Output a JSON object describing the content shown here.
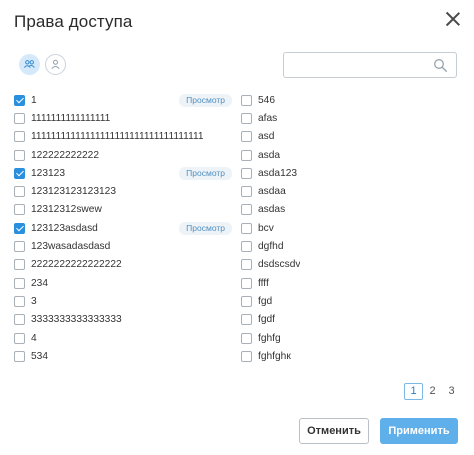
{
  "dialog": {
    "title": "Права доступа"
  },
  "icons": {
    "close": "close-icon",
    "mode_group": "users-group-icon",
    "mode_user": "single-user-icon",
    "search": "search-icon"
  },
  "colors": {
    "accent": "#2a8fdd",
    "apply_button": "#5fb0ea",
    "badge_bg": "#eef3f7",
    "badge_text": "#4f8fc0"
  },
  "search": {
    "placeholder": "",
    "value": ""
  },
  "left_items": [
    {
      "label": "1",
      "checked": true,
      "badge": "Просмотр"
    },
    {
      "label": "1111111111111111",
      "checked": false,
      "badge": ""
    },
    {
      "label": "11111111111111111111111111111111111",
      "checked": false,
      "badge": ""
    },
    {
      "label": "122222222222",
      "checked": false,
      "badge": ""
    },
    {
      "label": "123123",
      "checked": true,
      "badge": "Просмотр"
    },
    {
      "label": "123123123123123",
      "checked": false,
      "badge": ""
    },
    {
      "label": "12312312swew",
      "checked": false,
      "badge": ""
    },
    {
      "label": "123123asdasd",
      "checked": true,
      "badge": "Просмотр"
    },
    {
      "label": "123wasadasdasd",
      "checked": false,
      "badge": ""
    },
    {
      "label": "2222222222222222",
      "checked": false,
      "badge": ""
    },
    {
      "label": "234",
      "checked": false,
      "badge": ""
    },
    {
      "label": "3",
      "checked": false,
      "badge": ""
    },
    {
      "label": "3333333333333333",
      "checked": false,
      "badge": ""
    },
    {
      "label": "4",
      "checked": false,
      "badge": ""
    },
    {
      "label": "534",
      "checked": false,
      "badge": ""
    }
  ],
  "right_items": [
    {
      "label": "546",
      "checked": false
    },
    {
      "label": "afas",
      "checked": false
    },
    {
      "label": "asd",
      "checked": false
    },
    {
      "label": "asda",
      "checked": false
    },
    {
      "label": "asda123",
      "checked": false
    },
    {
      "label": "asdaa",
      "checked": false
    },
    {
      "label": "asdas",
      "checked": false
    },
    {
      "label": "bcv",
      "checked": false
    },
    {
      "label": "dgfhd",
      "checked": false
    },
    {
      "label": "dsdscsdv",
      "checked": false
    },
    {
      "label": "ffff",
      "checked": false
    },
    {
      "label": "fgd",
      "checked": false
    },
    {
      "label": "fgdf",
      "checked": false
    },
    {
      "label": "fghfg",
      "checked": false
    },
    {
      "label": "fghfghк",
      "checked": false
    }
  ],
  "pagination": {
    "pages": [
      "1",
      "2",
      "3"
    ],
    "current": "1"
  },
  "buttons": {
    "cancel": "Отменить",
    "apply": "Применить"
  }
}
